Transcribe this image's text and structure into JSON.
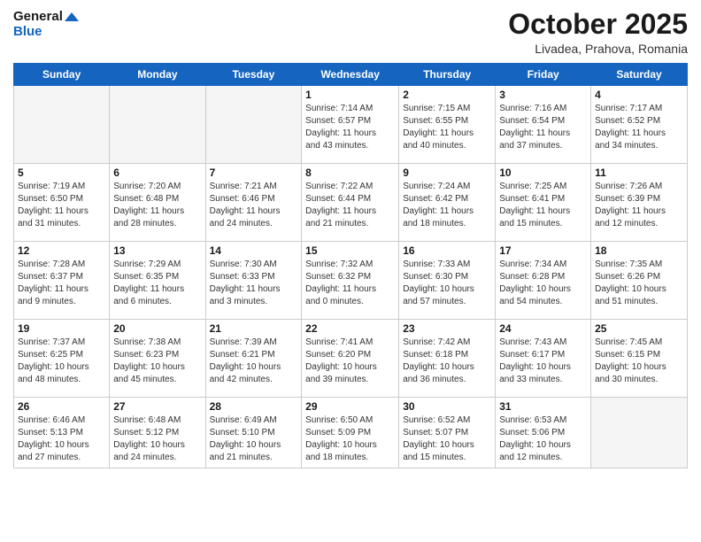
{
  "logo": {
    "line1": "General",
    "line2": "Blue"
  },
  "header": {
    "month": "October 2025",
    "location": "Livadea, Prahova, Romania"
  },
  "weekdays": [
    "Sunday",
    "Monday",
    "Tuesday",
    "Wednesday",
    "Thursday",
    "Friday",
    "Saturday"
  ],
  "weeks": [
    [
      {
        "day": "",
        "info": ""
      },
      {
        "day": "",
        "info": ""
      },
      {
        "day": "",
        "info": ""
      },
      {
        "day": "1",
        "info": "Sunrise: 7:14 AM\nSunset: 6:57 PM\nDaylight: 11 hours\nand 43 minutes."
      },
      {
        "day": "2",
        "info": "Sunrise: 7:15 AM\nSunset: 6:55 PM\nDaylight: 11 hours\nand 40 minutes."
      },
      {
        "day": "3",
        "info": "Sunrise: 7:16 AM\nSunset: 6:54 PM\nDaylight: 11 hours\nand 37 minutes."
      },
      {
        "day": "4",
        "info": "Sunrise: 7:17 AM\nSunset: 6:52 PM\nDaylight: 11 hours\nand 34 minutes."
      }
    ],
    [
      {
        "day": "5",
        "info": "Sunrise: 7:19 AM\nSunset: 6:50 PM\nDaylight: 11 hours\nand 31 minutes."
      },
      {
        "day": "6",
        "info": "Sunrise: 7:20 AM\nSunset: 6:48 PM\nDaylight: 11 hours\nand 28 minutes."
      },
      {
        "day": "7",
        "info": "Sunrise: 7:21 AM\nSunset: 6:46 PM\nDaylight: 11 hours\nand 24 minutes."
      },
      {
        "day": "8",
        "info": "Sunrise: 7:22 AM\nSunset: 6:44 PM\nDaylight: 11 hours\nand 21 minutes."
      },
      {
        "day": "9",
        "info": "Sunrise: 7:24 AM\nSunset: 6:42 PM\nDaylight: 11 hours\nand 18 minutes."
      },
      {
        "day": "10",
        "info": "Sunrise: 7:25 AM\nSunset: 6:41 PM\nDaylight: 11 hours\nand 15 minutes."
      },
      {
        "day": "11",
        "info": "Sunrise: 7:26 AM\nSunset: 6:39 PM\nDaylight: 11 hours\nand 12 minutes."
      }
    ],
    [
      {
        "day": "12",
        "info": "Sunrise: 7:28 AM\nSunset: 6:37 PM\nDaylight: 11 hours\nand 9 minutes."
      },
      {
        "day": "13",
        "info": "Sunrise: 7:29 AM\nSunset: 6:35 PM\nDaylight: 11 hours\nand 6 minutes."
      },
      {
        "day": "14",
        "info": "Sunrise: 7:30 AM\nSunset: 6:33 PM\nDaylight: 11 hours\nand 3 minutes."
      },
      {
        "day": "15",
        "info": "Sunrise: 7:32 AM\nSunset: 6:32 PM\nDaylight: 11 hours\nand 0 minutes."
      },
      {
        "day": "16",
        "info": "Sunrise: 7:33 AM\nSunset: 6:30 PM\nDaylight: 10 hours\nand 57 minutes."
      },
      {
        "day": "17",
        "info": "Sunrise: 7:34 AM\nSunset: 6:28 PM\nDaylight: 10 hours\nand 54 minutes."
      },
      {
        "day": "18",
        "info": "Sunrise: 7:35 AM\nSunset: 6:26 PM\nDaylight: 10 hours\nand 51 minutes."
      }
    ],
    [
      {
        "day": "19",
        "info": "Sunrise: 7:37 AM\nSunset: 6:25 PM\nDaylight: 10 hours\nand 48 minutes."
      },
      {
        "day": "20",
        "info": "Sunrise: 7:38 AM\nSunset: 6:23 PM\nDaylight: 10 hours\nand 45 minutes."
      },
      {
        "day": "21",
        "info": "Sunrise: 7:39 AM\nSunset: 6:21 PM\nDaylight: 10 hours\nand 42 minutes."
      },
      {
        "day": "22",
        "info": "Sunrise: 7:41 AM\nSunset: 6:20 PM\nDaylight: 10 hours\nand 39 minutes."
      },
      {
        "day": "23",
        "info": "Sunrise: 7:42 AM\nSunset: 6:18 PM\nDaylight: 10 hours\nand 36 minutes."
      },
      {
        "day": "24",
        "info": "Sunrise: 7:43 AM\nSunset: 6:17 PM\nDaylight: 10 hours\nand 33 minutes."
      },
      {
        "day": "25",
        "info": "Sunrise: 7:45 AM\nSunset: 6:15 PM\nDaylight: 10 hours\nand 30 minutes."
      }
    ],
    [
      {
        "day": "26",
        "info": "Sunrise: 6:46 AM\nSunset: 5:13 PM\nDaylight: 10 hours\nand 27 minutes."
      },
      {
        "day": "27",
        "info": "Sunrise: 6:48 AM\nSunset: 5:12 PM\nDaylight: 10 hours\nand 24 minutes."
      },
      {
        "day": "28",
        "info": "Sunrise: 6:49 AM\nSunset: 5:10 PM\nDaylight: 10 hours\nand 21 minutes."
      },
      {
        "day": "29",
        "info": "Sunrise: 6:50 AM\nSunset: 5:09 PM\nDaylight: 10 hours\nand 18 minutes."
      },
      {
        "day": "30",
        "info": "Sunrise: 6:52 AM\nSunset: 5:07 PM\nDaylight: 10 hours\nand 15 minutes."
      },
      {
        "day": "31",
        "info": "Sunrise: 6:53 AM\nSunset: 5:06 PM\nDaylight: 10 hours\nand 12 minutes."
      },
      {
        "day": "",
        "info": ""
      }
    ]
  ]
}
